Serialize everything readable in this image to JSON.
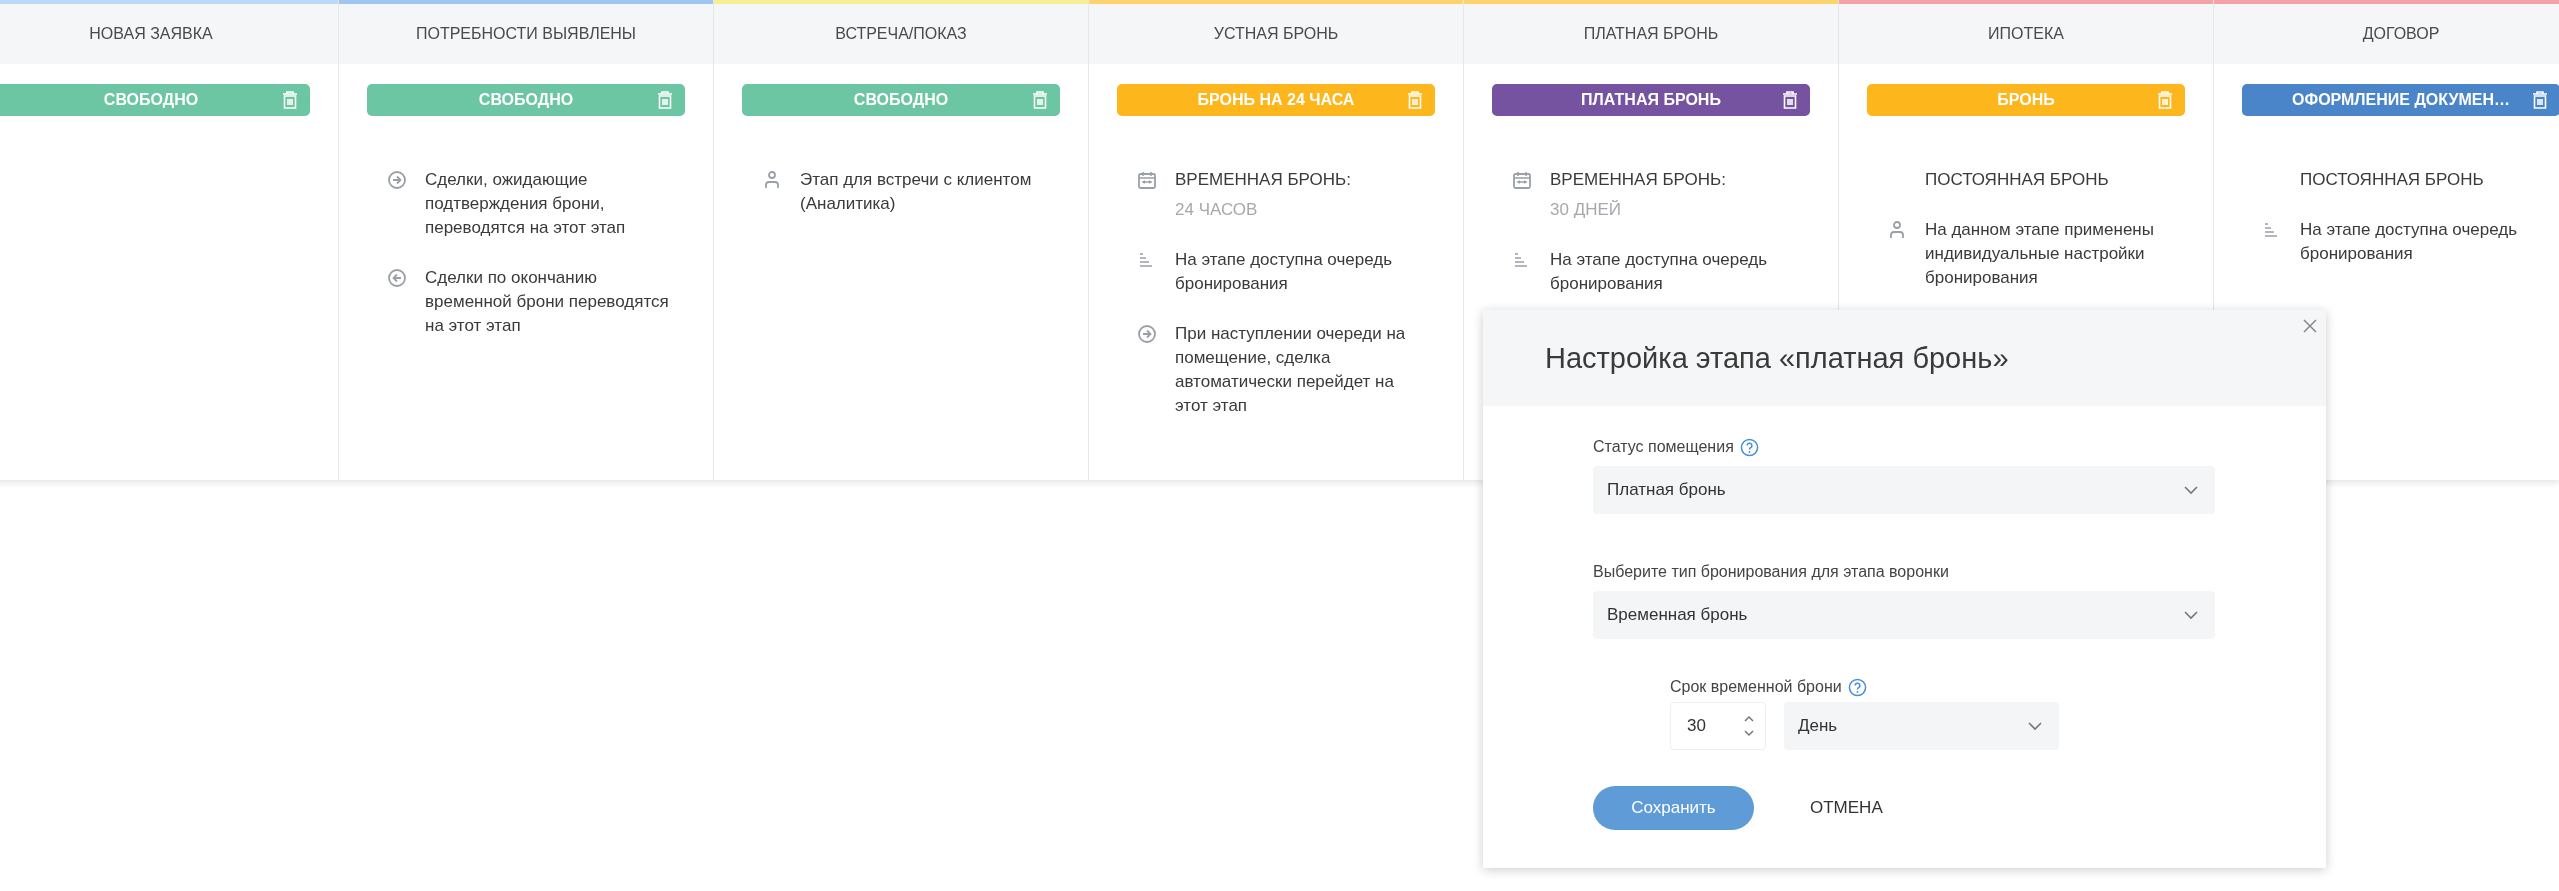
{
  "columns": [
    {
      "title": "НОВАЯ ЗАЯВКА",
      "color": "#bcdaf5",
      "badge": {
        "label": "СВОБОДНО",
        "color": "#6cc5a3"
      }
    },
    {
      "title": "ПОТРЕБНОСТИ ВЫЯВЛЕНЫ",
      "color": "#9fc6ee",
      "badge": {
        "label": "СВОБОДНО",
        "color": "#6cc5a3"
      },
      "items": [
        {
          "kind": "forward",
          "text": "Сделки, ожидающие подтверждения брони, переводятся на этот этап"
        },
        {
          "kind": "back",
          "text": "Сделки по окончанию временной брони переводятся на этот этап"
        }
      ]
    },
    {
      "title": "ВСТРЕЧА/ПОКАЗ",
      "color": "#f8ee94",
      "badge": {
        "label": "СВОБОДНО",
        "color": "#6cc5a3"
      },
      "items": [
        {
          "kind": "client",
          "text": "Этап для встречи с клиентом (Аналитика)"
        }
      ]
    },
    {
      "title": "УСТНАЯ БРОНЬ",
      "color": "#fdd36e",
      "badge": {
        "label": "БРОНЬ НА 24 ЧАСА",
        "color": "#fdb61b"
      },
      "items": [
        {
          "kind": "term",
          "text": "ВРЕМЕННАЯ БРОНЬ:",
          "sub": "24 ЧАСОВ"
        },
        {
          "kind": "queue",
          "text": "На этапе доступна очередь бронирования"
        },
        {
          "kind": "forward",
          "text": "При наступлении очереди на помещение, сделка автоматически перейдет на этот этап"
        }
      ]
    },
    {
      "title": "ПЛАТНАЯ БРОНЬ",
      "color": "#fdd36e",
      "badge": {
        "label": "ПЛАТНАЯ БРОНЬ",
        "color": "#7553a1"
      },
      "items": [
        {
          "kind": "term",
          "text": "ВРЕМЕННАЯ БРОНЬ:",
          "sub": "30 ДНЕЙ"
        },
        {
          "kind": "queue",
          "text": "На этапе доступна очередь бронирования"
        }
      ]
    },
    {
      "title": "ИПОТЕКА",
      "color": "#f5a1a9",
      "badge": {
        "label": "БРОНЬ",
        "color": "#fdb61b"
      },
      "items": [
        {
          "kind": "plain",
          "text": "ПОСТОЯННАЯ БРОНЬ"
        },
        {
          "kind": "client",
          "text": "На данном этапе применены индивидуальные настройки бронирования"
        }
      ]
    },
    {
      "title": "ДОГОВОР",
      "color": "#f5a1a9",
      "badge": {
        "label": "ОФОРМЛЕНИЕ ДОКУМЕН…",
        "color": "#4a84c9"
      },
      "items": [
        {
          "kind": "plain",
          "text": "ПОСТОЯННАЯ БРОНЬ"
        },
        {
          "kind": "queue",
          "text": "На этапе доступна очередь бронирования"
        }
      ]
    }
  ],
  "modal": {
    "title": "Настройка этапа «платная бронь»",
    "fields": [
      {
        "label": "Статус помещения",
        "help": true,
        "value": "Платная бронь"
      },
      {
        "label": "Выберите тип бронирования для этапа воронки",
        "help": false,
        "value": "Временная бронь"
      }
    ],
    "duration": {
      "label": "Срок временной брони",
      "help": true,
      "number": "30",
      "unit": "День"
    },
    "save": "Сохранить",
    "cancel": "ОТМЕНА"
  }
}
